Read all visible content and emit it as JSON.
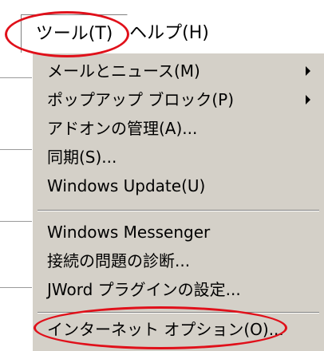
{
  "menubar": {
    "tools_label": "ツール(T)",
    "help_label": "ヘルプ(H)"
  },
  "tools_menu": {
    "items": [
      {
        "label": "メールとニュース(M)",
        "has_submenu": true
      },
      {
        "label": "ポップアップ ブロック(P)",
        "has_submenu": true
      },
      {
        "label": "アドオンの管理(A)..."
      },
      {
        "label": "同期(S)..."
      },
      {
        "label": "Windows Update(U)"
      },
      {
        "label": "Windows Messenger"
      },
      {
        "label": "接続の問題の診断..."
      },
      {
        "label": "JWord プラグインの設定..."
      },
      {
        "label": "インターネット オプション(O)..."
      }
    ]
  },
  "colors": {
    "menu_background": "#d4d0c8",
    "annotation": "#e0101a"
  }
}
